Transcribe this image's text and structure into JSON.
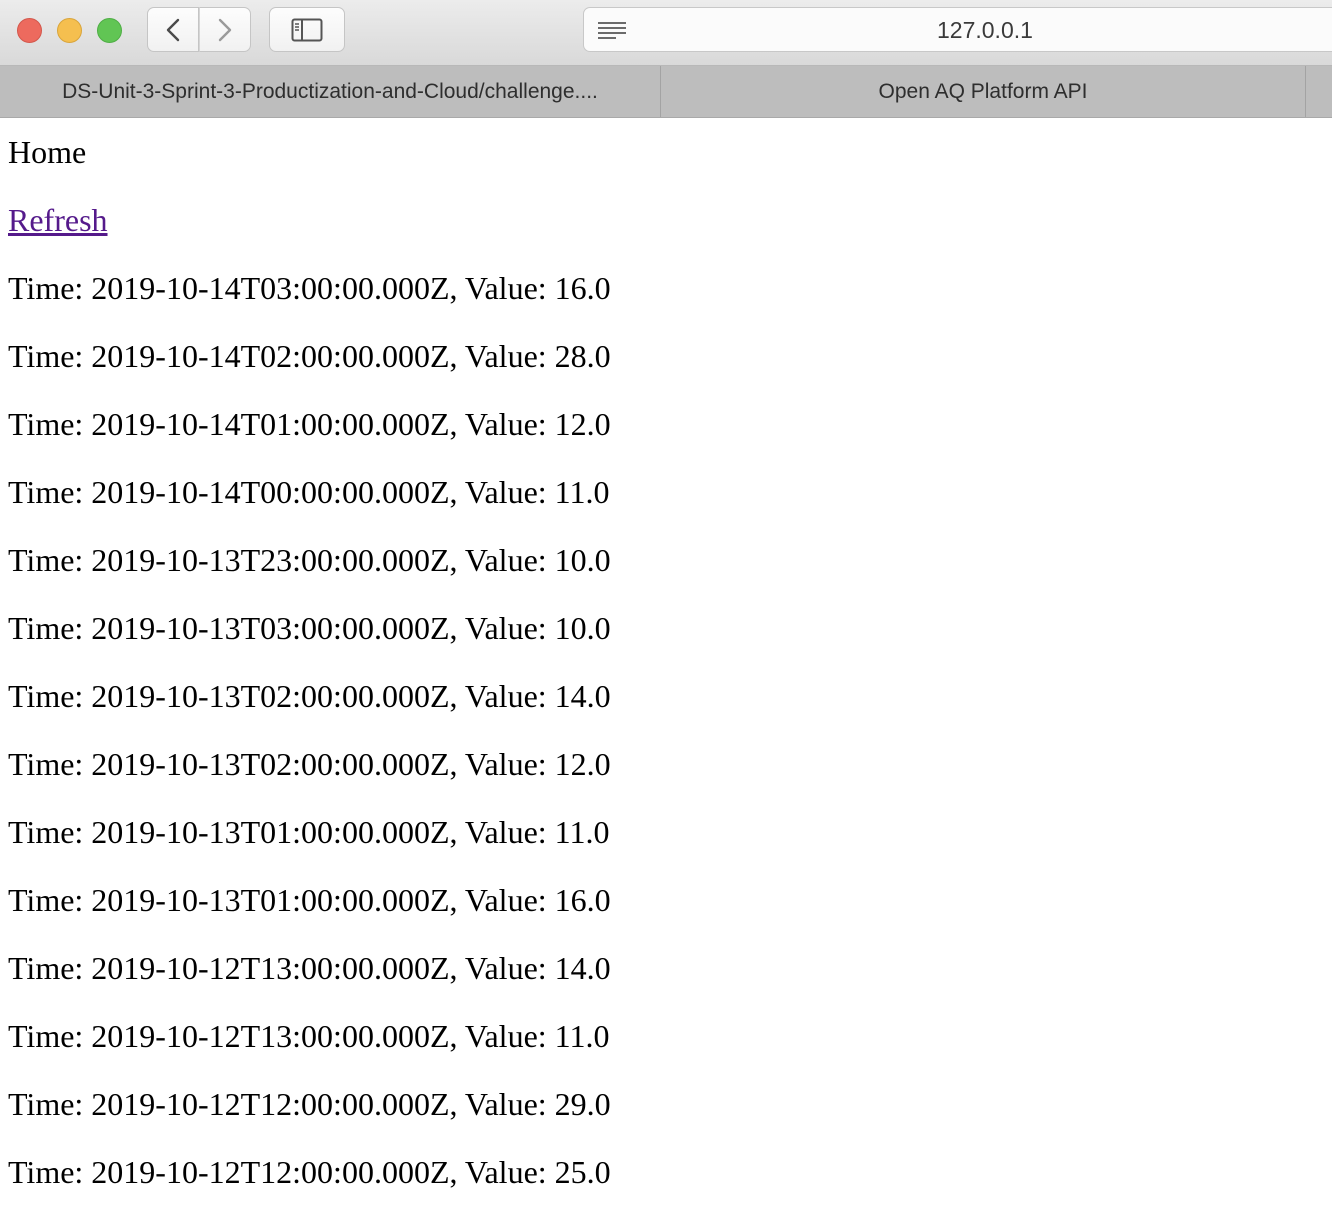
{
  "browser": {
    "address": "127.0.0.1",
    "tabs": [
      {
        "label": "DS-Unit-3-Sprint-3-Productization-and-Cloud/challenge...."
      },
      {
        "label": "Open AQ Platform API"
      }
    ]
  },
  "page": {
    "heading": "Home",
    "refresh_link": "Refresh",
    "records": [
      "Time: 2019-10-14T03:00:00.000Z, Value: 16.0",
      "Time: 2019-10-14T02:00:00.000Z, Value: 28.0",
      "Time: 2019-10-14T01:00:00.000Z, Value: 12.0",
      "Time: 2019-10-14T00:00:00.000Z, Value: 11.0",
      "Time: 2019-10-13T23:00:00.000Z, Value: 10.0",
      "Time: 2019-10-13T03:00:00.000Z, Value: 10.0",
      "Time: 2019-10-13T02:00:00.000Z, Value: 14.0",
      "Time: 2019-10-13T02:00:00.000Z, Value: 12.0",
      "Time: 2019-10-13T01:00:00.000Z, Value: 11.0",
      "Time: 2019-10-13T01:00:00.000Z, Value: 16.0",
      "Time: 2019-10-12T13:00:00.000Z, Value: 14.0",
      "Time: 2019-10-12T13:00:00.000Z, Value: 11.0",
      "Time: 2019-10-12T12:00:00.000Z, Value: 29.0",
      "Time: 2019-10-12T12:00:00.000Z, Value: 25.0"
    ]
  },
  "colors": {
    "link": "#551a8b",
    "traffic_close": "#ed6a5e",
    "traffic_minimize": "#f5bf4f",
    "traffic_maximize": "#61c554"
  }
}
